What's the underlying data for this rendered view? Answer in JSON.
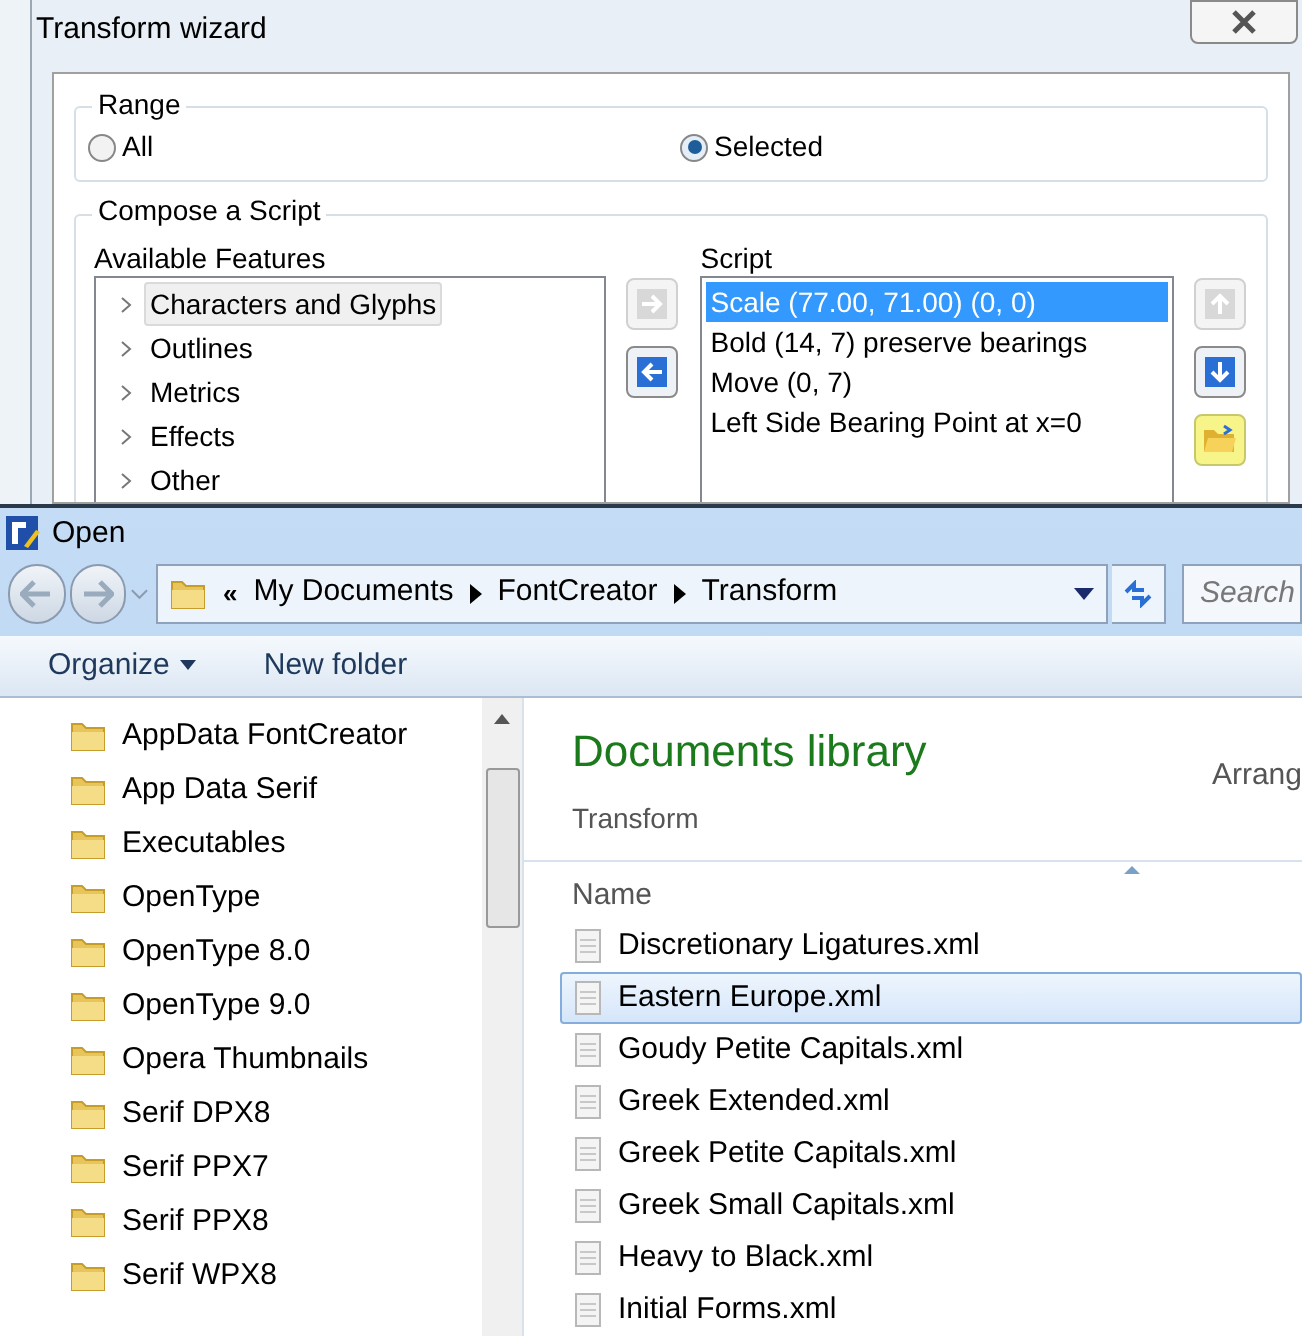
{
  "wizard": {
    "title": "Transform wizard",
    "range": {
      "label": "Range",
      "options": [
        {
          "label": "All",
          "selected": false
        },
        {
          "label": "Selected",
          "selected": true
        }
      ]
    },
    "compose": {
      "label": "Compose a Script",
      "features_label": "Available Features",
      "features": [
        {
          "label": "Characters and Glyphs",
          "selected": true
        },
        {
          "label": "Outlines",
          "selected": false
        },
        {
          "label": "Metrics",
          "selected": false
        },
        {
          "label": "Effects",
          "selected": false
        },
        {
          "label": "Other",
          "selected": false
        }
      ],
      "move_buttons": [
        {
          "kind": "right",
          "disabled": true
        },
        {
          "kind": "left",
          "disabled": false
        }
      ],
      "script_label": "Script",
      "script": [
        {
          "label": "Scale (77.00, 71.00) (0, 0)",
          "selected": true
        },
        {
          "label": "Bold (14, 7) preserve bearings",
          "selected": false
        },
        {
          "label": "Move (0, 7)",
          "selected": false
        },
        {
          "label": "Left Side Bearing Point at x=0",
          "selected": false
        }
      ],
      "order_buttons": [
        {
          "kind": "up",
          "disabled": true
        },
        {
          "kind": "down",
          "disabled": false
        },
        {
          "kind": "open",
          "highlighted": true
        }
      ]
    }
  },
  "open_dialog": {
    "title": "Open",
    "address": {
      "overflow": "«",
      "crumbs": [
        "My Documents",
        "FontCreator",
        "Transform"
      ]
    },
    "search": {
      "placeholder": "Search"
    },
    "toolbar": [
      {
        "kind": "menu",
        "label": "Organize"
      },
      {
        "kind": "button",
        "label": "New folder"
      }
    ],
    "folders": [
      "AppData FontCreator",
      "App Data Serif",
      "Executables",
      "OpenType",
      "OpenType 8.0",
      "OpenType 9.0",
      "Opera Thumbnails",
      "Serif DPX8",
      "Serif PPX7",
      "Serif PPX8",
      "Serif WPX8"
    ],
    "library": {
      "title": "Documents library",
      "subtitle": "Transform",
      "arrange": "Arrang"
    },
    "column": "Name",
    "files": [
      {
        "name": "Discretionary Ligatures.xml",
        "selected": false
      },
      {
        "name": "Eastern Europe.xml",
        "selected": true
      },
      {
        "name": "Goudy Petite Capitals.xml",
        "selected": false
      },
      {
        "name": "Greek Extended.xml",
        "selected": false
      },
      {
        "name": "Greek Petite Capitals.xml",
        "selected": false
      },
      {
        "name": "Greek Small Capitals.xml",
        "selected": false
      },
      {
        "name": "Heavy to Black.xml",
        "selected": false
      },
      {
        "name": "Initial Forms.xml",
        "selected": false
      }
    ]
  }
}
